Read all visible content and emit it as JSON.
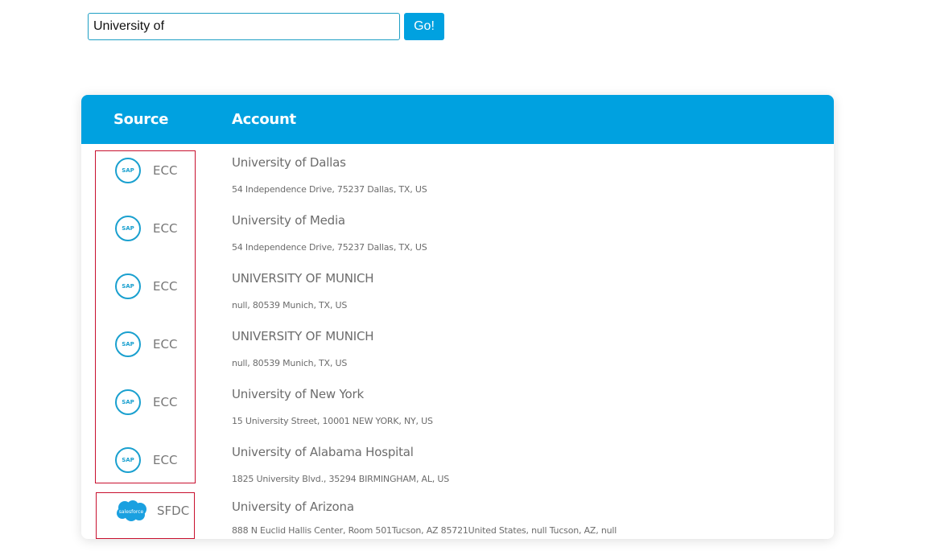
{
  "search": {
    "value": "University of",
    "go_label": "Go!"
  },
  "table": {
    "headers": {
      "source": "Source",
      "account": "Account"
    },
    "rows": [
      {
        "logo": "sap-logo",
        "logo_text": "SAP",
        "source": "ECC",
        "name": "University of Dallas",
        "address": "54 Independence Drive, 75237 Dallas, TX, US"
      },
      {
        "logo": "sap-logo",
        "logo_text": "SAP",
        "source": "ECC",
        "name": "University of Media",
        "address": "54 Independence Drive, 75237 Dallas, TX, US"
      },
      {
        "logo": "sap-logo",
        "logo_text": "SAP",
        "source": "ECC",
        "name": "UNIVERSITY OF MUNICH",
        "address": "null, 80539 Munich, TX, US"
      },
      {
        "logo": "sap-logo",
        "logo_text": "SAP",
        "source": "ECC",
        "name": "UNIVERSITY OF MUNICH",
        "address": "null, 80539 Munich, TX, US"
      },
      {
        "logo": "sap-logo",
        "logo_text": "SAP",
        "source": "ECC",
        "name": "University of New York",
        "address": "15 University Street, 10001 NEW YORK, NY, US"
      },
      {
        "logo": "sap-logo",
        "logo_text": "SAP",
        "source": "ECC",
        "name": "University of Alabama Hospital",
        "address": "1825 University Blvd., 35294 BIRMINGHAM, AL, US"
      },
      {
        "logo": "salesforce-logo",
        "logo_text": "salesforce",
        "source": "SFDC",
        "name": "University of Arizona",
        "address": "888 N Euclid Hallis Center, Room 501Tucson, AZ 85721United States, null Tucson, AZ, null"
      }
    ]
  },
  "colors": {
    "accent": "#00a1e0",
    "highlight": "#c8102e",
    "text": "#6c6c6c"
  }
}
